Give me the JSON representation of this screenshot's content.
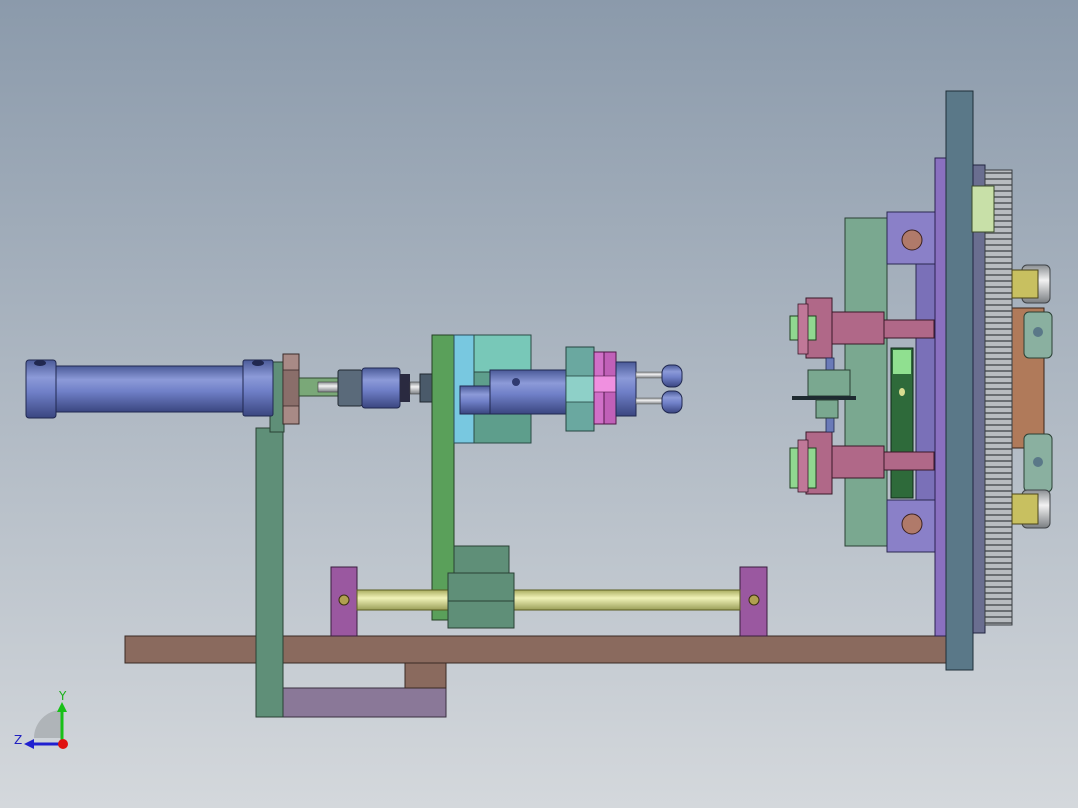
{
  "viewport": {
    "background_top": "#8b9aab",
    "background_bottom": "#d4d8dc"
  },
  "triad": {
    "y_label": "Y",
    "z_label": "Z",
    "y_color": "#18c018",
    "z_color": "#2020d0",
    "x_color": "#e01010"
  },
  "part_colors": {
    "cylinder_blue": "#6f7fc0",
    "frame_green": "#5f8f78",
    "plate_green": "#5aa05a",
    "base_brown": "#8a6a5e",
    "bracket_purple": "#9a58a0",
    "rod_yellow": "#d8dc90",
    "nut_pink": "#d070c8",
    "cyan_block": "#78c8c0",
    "slate_plate": "#5a7888",
    "gear_gray": "#c8ccd0",
    "copper": "#b07a5a",
    "lavender": "#8a80c8",
    "mauve": "#b06888",
    "bolt_yellow": "#c8c060"
  }
}
